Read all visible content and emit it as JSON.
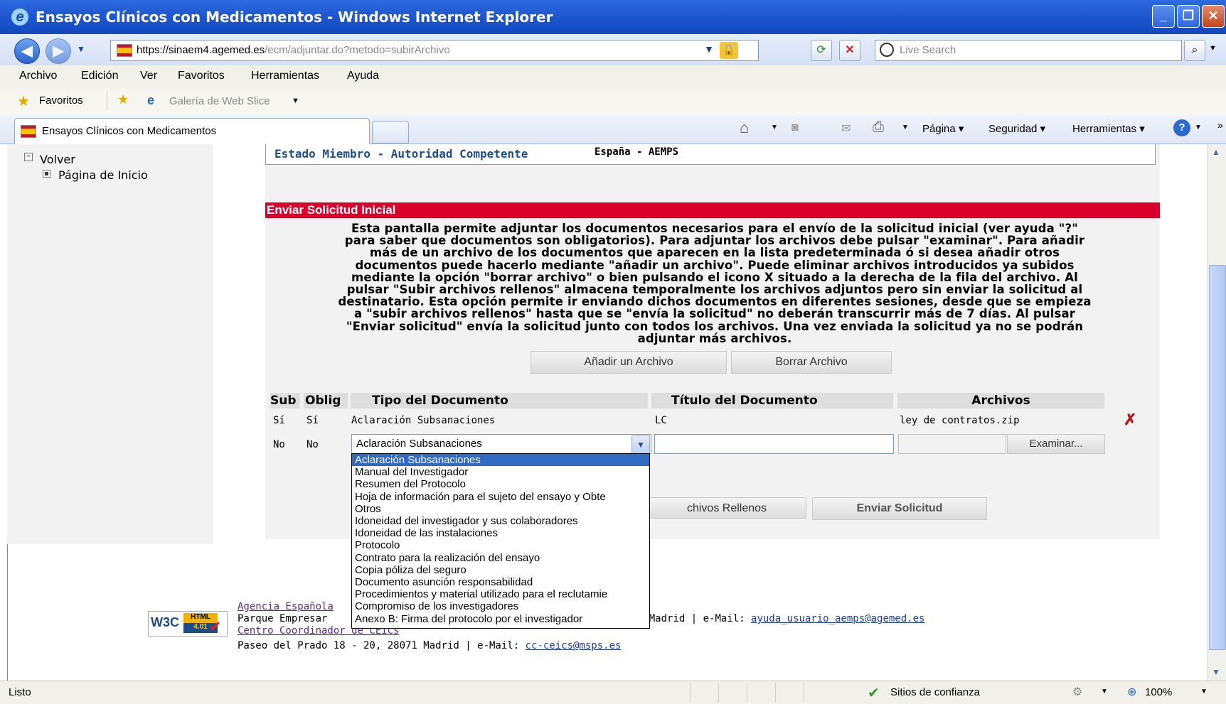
{
  "window": {
    "title": "Ensayos Clínicos con Medicamentos - Windows Internet Explorer"
  },
  "address": {
    "host": "https://sinaem4.agemed.es",
    "path": "/ecm/adjuntar.do?metodo=subirArchivo",
    "search_placeholder": "Live Search"
  },
  "menu": [
    "Archivo",
    "Edición",
    "Ver",
    "Favoritos",
    "Herramientas",
    "Ayuda"
  ],
  "favbar": {
    "favorites": "Favoritos",
    "webslice": "Galería de Web Slice"
  },
  "tab": {
    "title": "Ensayos Clínicos con Medicamentos"
  },
  "toolbar": {
    "page": "Página",
    "security": "Seguridad",
    "tools": "Herramientas"
  },
  "sidebar": {
    "back": "Volver",
    "home": "Página de Inicio"
  },
  "estado": {
    "label": "Estado Miembro - Autoridad Competente",
    "value": "España - AEMPS"
  },
  "section": {
    "title": "Enviar Solicitud Inicial"
  },
  "intro": [
    "Esta pantalla permite adjuntar los documentos necesarios para el envío de la solicitud inicial (ver ayuda \"?\"",
    "para saber que documentos son obligatorios). Para adjuntar los archivos debe pulsar \"examinar\". Para añadir",
    "más de un archivo de los documentos que aparecen en la lista predeterminada ó si desea añadir otros",
    "documentos puede hacerlo mediante \"añadir un archivo\". Puede eliminar archivos introducidos ya subidos",
    "mediante la opción \"borrar archivo\" o bien pulsando el icono X situado a la derecha de la fila del archivo. Al",
    "pulsar \"Subir archivos rellenos\" almacena temporalmente los archivos adjuntos pero sin enviar la solicitud al",
    "destinatario. Esta opción permite ir enviando dichos documentos en diferentes sesiones, desde que se empieza",
    "a \"subir archivos rellenos\" hasta que se \"envía la solicitud\" no deberán transcurrir más de 7 días. Al pulsar",
    "\"Enviar solicitud\" envía la solicitud junto con todos los archivos. Una vez enviada la solicitud ya no se podrán",
    "adjuntar más archivos."
  ],
  "buttons": {
    "add": "Añadir un Archivo",
    "delete": "Borrar Archivo",
    "upload": "chivos Rellenos",
    "send": "Enviar Solicitud",
    "browse": "Examinar..."
  },
  "table": {
    "headers": [
      "Sub",
      "Oblig",
      "Tipo del Documento",
      "Título del Documento",
      "Archivos"
    ],
    "row1": {
      "sub": "Sí",
      "oblig": "Sí",
      "tipo": "Aclaración Subsanaciones",
      "titulo": "LC",
      "archivo": "ley de contratos.zip"
    },
    "row2": {
      "sub": "No",
      "oblig": "No",
      "tipo_selected": "Aclaración Subsanaciones"
    }
  },
  "dropdown_options": [
    "Aclaración Subsanaciones",
    "Manual del Investigador",
    "Resumen del Protocolo",
    "Hoja de información para el sujeto del ensayo y Obte",
    "Otros",
    "Idoneidad del investigador y sus colaboradores",
    "Idoneidad de las instalaciones",
    "Protocolo",
    "Contrato para la realización del ensayo",
    "Copia póliza del seguro",
    "Documento asunción responsabilidad",
    "Procedimientos y material utilizado para el reclutamie",
    "Compromiso de los investigadores",
    "Anexo B: Firma del protocolo por el investigador"
  ],
  "footer": {
    "agency_link": "Agencia Española",
    "line2_prefix": "Parque Empresar",
    "line2_suffix": "1 - 28022 Madrid | e-Mail: ",
    "email1": "ayuda_usuario_aemps@agemed.es",
    "ceic_link": "Centro Coordinador de CEICs",
    "line4": "Paseo del Prado 18 - 20, 28071 Madrid | e-Mail: ",
    "email2": "cc-ceics@msps.es",
    "w3c_badge": "W3C HTML 4.01"
  },
  "status": {
    "left": "Listo",
    "zone": "Sitios de confianza",
    "zoom": "100%"
  },
  "colors": {
    "title_blue": "#1e57d0",
    "section_red": "#d8002b",
    "select_highlight": "#316ac5"
  }
}
